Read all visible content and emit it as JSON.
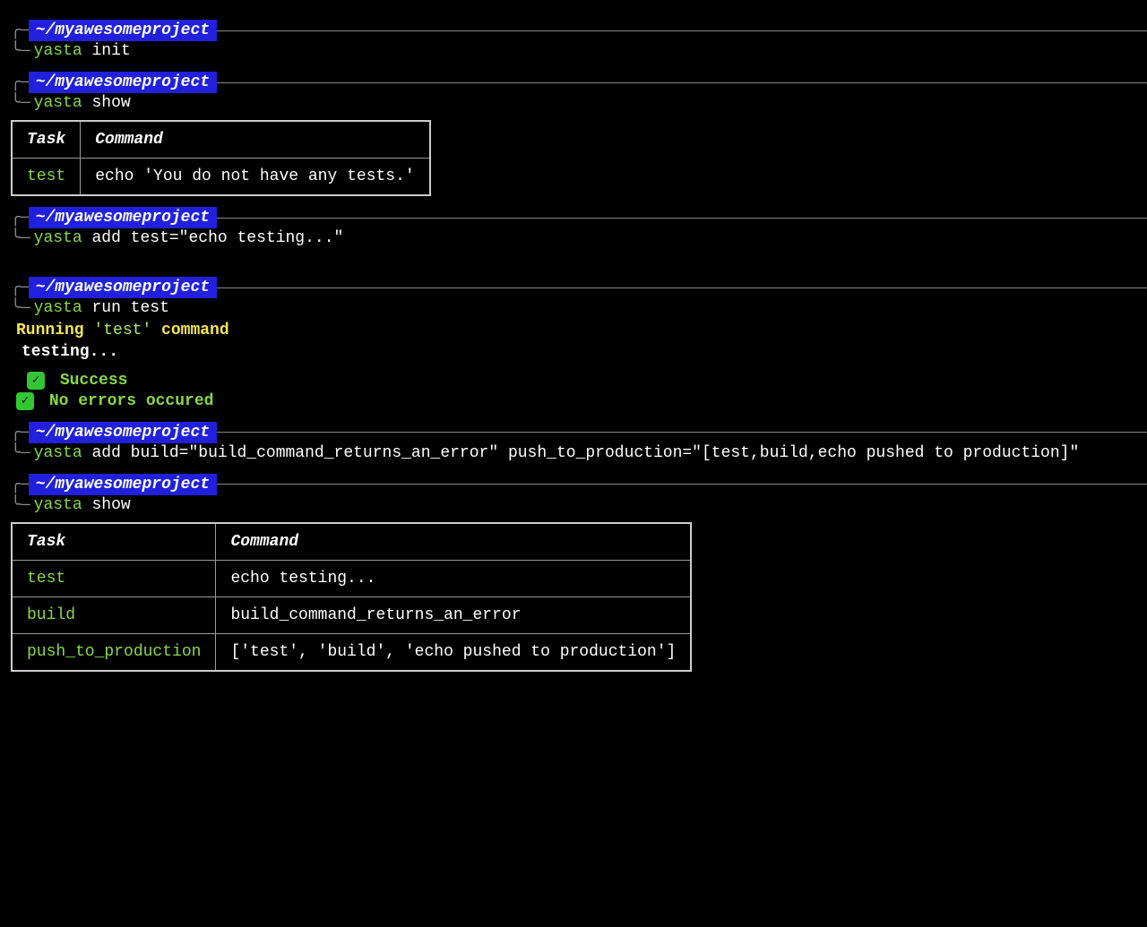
{
  "prompts": [
    {
      "path": "~/myawesomeproject",
      "tool": "yasta",
      "args": "init"
    },
    {
      "path": "~/myawesomeproject",
      "tool": "yasta",
      "args": "show"
    },
    {
      "path": "~/myawesomeproject",
      "tool": "yasta",
      "args": "add test=\"echo testing...\""
    },
    {
      "path": "~/myawesomeproject",
      "tool": "yasta",
      "args": "run test"
    },
    {
      "path": "~/myawesomeproject",
      "tool": "yasta",
      "args": "add build=\"build_command_returns_an_error\" push_to_production=\"[test,build,echo pushed to production]\""
    },
    {
      "path": "~/myawesomeproject",
      "tool": "yasta",
      "args": "show"
    }
  ],
  "table1": {
    "headers": [
      "Task",
      "Command"
    ],
    "rows": [
      {
        "task": "test",
        "command": "echo 'You do not have any tests.'"
      }
    ]
  },
  "run_output": {
    "running_prefix": "Running ",
    "running_quoted": "'test'",
    "running_suffix": " command",
    "stdout": "testing...",
    "success": "Success",
    "no_errors": "No errors occured"
  },
  "table2": {
    "headers": [
      "Task",
      "Command"
    ],
    "rows": [
      {
        "task": "test",
        "command": "echo testing..."
      },
      {
        "task": "build",
        "command": "build_command_returns_an_error"
      },
      {
        "task": "push_to_production",
        "command": "['test', 'build', 'echo pushed to production']"
      }
    ]
  },
  "icons": {
    "check": "✓"
  }
}
